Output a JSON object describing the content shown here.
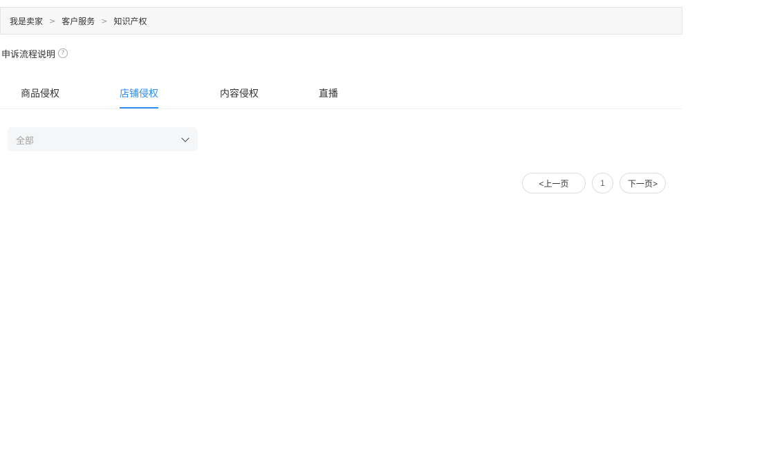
{
  "breadcrumb": {
    "items": [
      "我是卖家",
      "客户服务",
      "知识产权"
    ],
    "separator": ">"
  },
  "help": {
    "label": "申诉流程说明",
    "icon": "question-circle-icon",
    "icon_glyph": "?"
  },
  "tabs": [
    {
      "label": "商品侵权",
      "active": false
    },
    {
      "label": "店铺侵权",
      "active": true
    },
    {
      "label": "内容侵权",
      "active": false
    },
    {
      "label": "直播",
      "active": false
    }
  ],
  "filter": {
    "selected": "全部",
    "icon": "chevron-down-icon"
  },
  "pagination": {
    "prev_label": "<上一页",
    "current_page": "1",
    "next_label": "下一页>"
  },
  "colors": {
    "accent": "#2d8cf0",
    "breadcrumb_bg": "#f7f7f7",
    "select_bg": "#f5f6f7"
  }
}
